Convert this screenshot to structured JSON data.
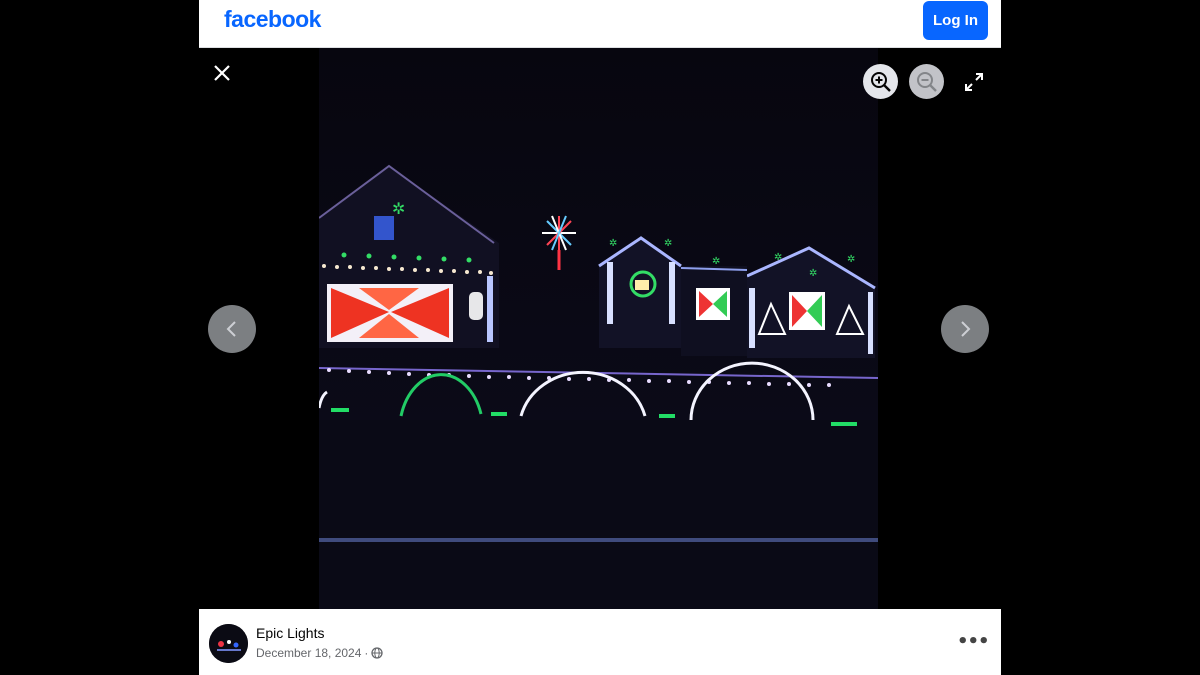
{
  "header": {
    "logo_text": "facebook",
    "login_label": "Log In",
    "brand_color": "#0866ff"
  },
  "viewer": {
    "icons": {
      "close": "close-icon",
      "zoom_in": "zoom-in-icon",
      "zoom_out": "zoom-out-icon",
      "fullscreen": "fullscreen-icon",
      "prev": "chevron-left-icon",
      "next": "chevron-right-icon"
    },
    "zoom_out_enabled": false
  },
  "post": {
    "author": "Epic Lights",
    "date": "December 18, 2024",
    "separator": "·",
    "audience_icon": "globe-icon",
    "more_icon": "more-horizontal-icon",
    "more_glyph": "•••"
  }
}
